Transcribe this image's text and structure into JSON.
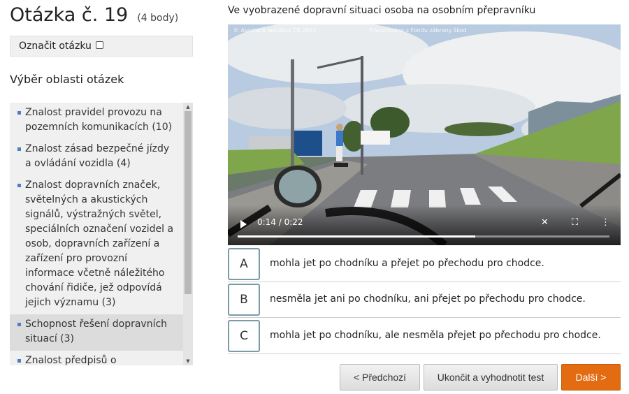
{
  "question": {
    "title": "Otázka č. 19",
    "points": "(4 body)",
    "mark_label": "Označit otázku",
    "text": "Ve vyobrazené dopravní situaci osoba na osobním přepravníku"
  },
  "areas": {
    "title": "Výběr oblasti otázek",
    "items": [
      {
        "label": "Znalost pravidel provozu na pozemních komunikacích (10)",
        "selected": false
      },
      {
        "label": "Znalost zásad bezpečné jízdy a ovládání vozidla (4)",
        "selected": false
      },
      {
        "label": "Znalost dopravních značek, světelných a akustických signálů, výstražných světel, speciálních označení vozidel a osob, dopravních zařízení a zařízení pro provozní informace včetně náležitého chování řidiče, jež odpovídá jejich významu (3)",
        "selected": false
      },
      {
        "label": "Schopnost řešení dopravních situací (3)",
        "selected": true
      },
      {
        "label": "Znalost předpisů o podmínkách provozu vozidel na pozemních",
        "selected": false
      }
    ]
  },
  "video": {
    "watermark_left": "© Asociace autoškol ČR 2021",
    "watermark_center": "Financováno z Fondu zábrany škod",
    "time": "0:14 / 0:22",
    "progress": 0.64
  },
  "answers": [
    {
      "letter": "A",
      "text": "mohla jet po chodníku a přejet po přechodu pro chodce."
    },
    {
      "letter": "B",
      "text": "nesměla jet ani po chodníku, ani přejet po přechodu pro chodce."
    },
    {
      "letter": "C",
      "text": "mohla jet po chodníku, ale nesměla přejet po přechodu pro chodce."
    }
  ],
  "buttons": {
    "prev": "< Předchozí",
    "finish": "Ukončit a vyhodnotit test",
    "next": "Další >"
  },
  "colors": {
    "accent": "#e36c13",
    "bullet": "#4f7fbf"
  }
}
